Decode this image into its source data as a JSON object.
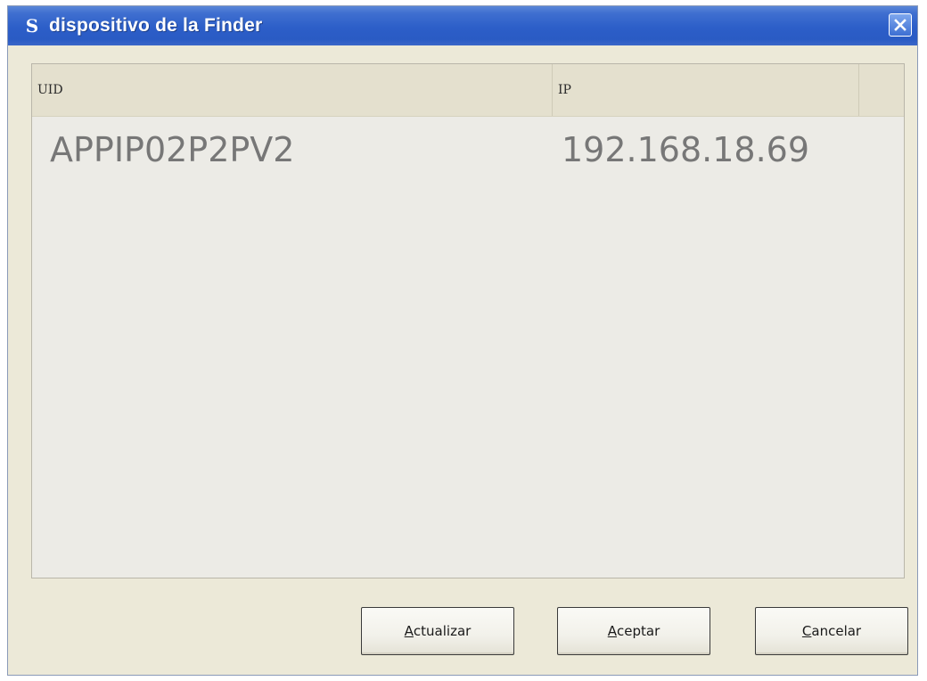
{
  "window": {
    "title": "dispositivo de la Finder",
    "app_icon": "app-s-icon",
    "close_icon": "close-icon"
  },
  "list": {
    "columns": [
      "UID",
      "IP"
    ],
    "rows": [
      {
        "uid": "APPIP02P2PV2",
        "ip": "192.168.18.69"
      }
    ]
  },
  "buttons": {
    "refresh": {
      "mnemonic": "A",
      "rest": "ctualizar"
    },
    "accept": {
      "mnemonic": "A",
      "rest": "ceptar"
    },
    "cancel": {
      "mnemonic": "C",
      "rest": "ancelar"
    }
  },
  "colors": {
    "titlebar": "#2c5ec8",
    "window_bg": "#ece9d8",
    "list_bg": "#ecebe6",
    "header_bg": "#e4e0ce",
    "row_text": "#777777"
  }
}
